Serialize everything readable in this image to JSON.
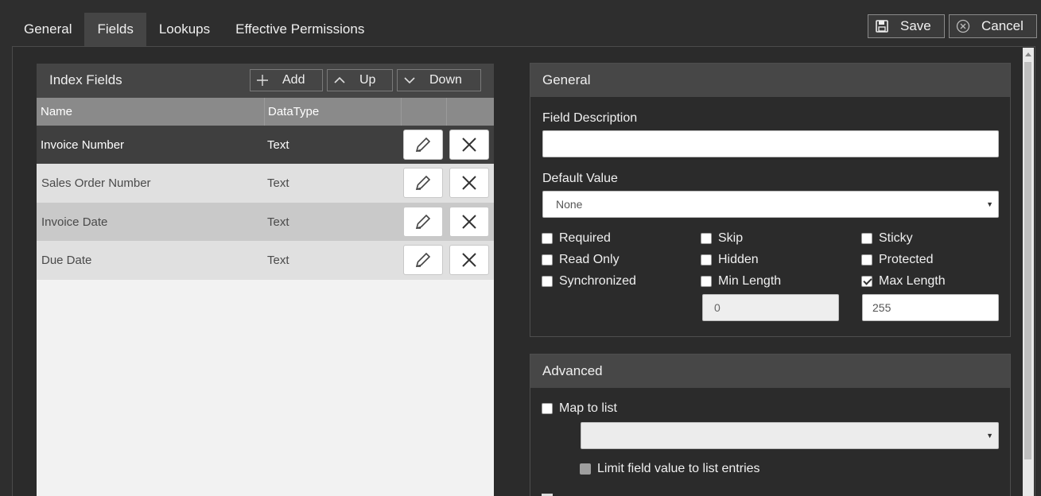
{
  "tabs": [
    {
      "label": "General",
      "active": false
    },
    {
      "label": "Fields",
      "active": true
    },
    {
      "label": "Lookups",
      "active": false
    },
    {
      "label": "Effective Permissions",
      "active": false
    }
  ],
  "toolbar": {
    "save_label": "Save",
    "cancel_label": "Cancel"
  },
  "index_fields": {
    "title": "Index Fields",
    "add_label": "Add",
    "up_label": "Up",
    "down_label": "Down",
    "columns": {
      "name": "Name",
      "datatype": "DataType"
    },
    "rows": [
      {
        "name": "Invoice Number",
        "datatype": "Text",
        "selected": true
      },
      {
        "name": "Sales Order Number",
        "datatype": "Text"
      },
      {
        "name": "Invoice Date",
        "datatype": "Text"
      },
      {
        "name": "Due Date",
        "datatype": "Text"
      }
    ]
  },
  "general": {
    "title": "General",
    "field_description_label": "Field Description",
    "field_description_value": "",
    "default_value_label": "Default Value",
    "default_value_selected": "None",
    "checkboxes": {
      "required": {
        "label": "Required",
        "checked": false
      },
      "skip": {
        "label": "Skip",
        "checked": false
      },
      "sticky": {
        "label": "Sticky",
        "checked": false
      },
      "read_only": {
        "label": "Read Only",
        "checked": false
      },
      "hidden": {
        "label": "Hidden",
        "checked": false
      },
      "protected": {
        "label": "Protected",
        "checked": false
      },
      "synchronized": {
        "label": "Synchronized",
        "checked": false
      },
      "min_length": {
        "label": "Min Length",
        "checked": false
      },
      "max_length": {
        "label": "Max Length",
        "checked": true
      }
    },
    "min_length_value": "0",
    "max_length_value": "255"
  },
  "advanced": {
    "title": "Advanced",
    "map_to_list_label": "Map to list",
    "map_to_list_selected": "",
    "limit_label": "Limit field value to list entries"
  },
  "colors": {
    "background": "#2e2e2e",
    "panel_header": "#454545",
    "selected_row": "#3f3f3f"
  }
}
